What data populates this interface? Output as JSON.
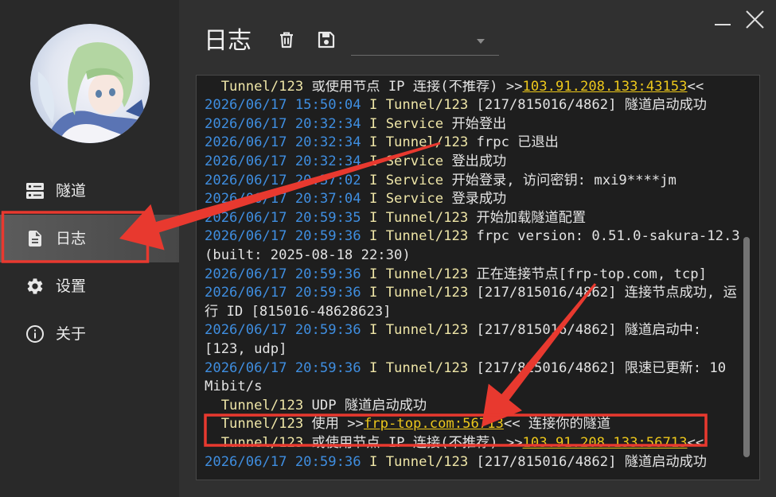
{
  "window_controls": {
    "minimize_icon": "minimize-icon",
    "close_icon": "close-icon"
  },
  "sidebar": {
    "items": [
      {
        "label": "隧道",
        "icon": "server-icon",
        "active": false
      },
      {
        "label": "日志",
        "icon": "file-text-icon",
        "active": true
      },
      {
        "label": "设置",
        "icon": "gear-icon",
        "active": false
      },
      {
        "label": "关于",
        "icon": "info-icon",
        "active": false
      }
    ]
  },
  "header": {
    "title": "日志",
    "clear_icon": "trash-icon",
    "save_icon": "save-icon",
    "filter": {
      "value": "",
      "icon": "chevron-down-icon"
    }
  },
  "log": {
    "lines": [
      {
        "indent": true,
        "source": "Tunnel/123",
        "message": [
          {
            "text": "或使用节点 IP 连接(不推荐) >>"
          },
          {
            "text": "103.91.208.133:43153",
            "link": true
          },
          {
            "text": "<<"
          }
        ]
      },
      {
        "time": "2026/06/17 15:50:04",
        "level": "I",
        "source": "Tunnel/123",
        "message": [
          {
            "text": "[217/815016/4862] 隧道启动成功"
          }
        ]
      },
      {
        "time": "2026/06/17 20:32:34",
        "level": "I",
        "source": "Service",
        "message": [
          {
            "text": "开始登出"
          }
        ]
      },
      {
        "time": "2026/06/17 20:32:34",
        "level": "I",
        "source": "Tunnel/123",
        "message": [
          {
            "text": "frpc 已退出"
          }
        ]
      },
      {
        "time": "2026/06/17 20:32:34",
        "level": "I",
        "source": "Service",
        "message": [
          {
            "text": "登出成功"
          }
        ]
      },
      {
        "time": "2026/06/17 20:37:02",
        "level": "I",
        "source": "Service",
        "message": [
          {
            "text": "开始登录, 访问密钥: mxi9****jm"
          }
        ]
      },
      {
        "time": "2026/06/17 20:37:04",
        "level": "I",
        "source": "Service",
        "message": [
          {
            "text": "登录成功"
          }
        ]
      },
      {
        "time": "2026/06/17 20:59:35",
        "level": "I",
        "source": "Tunnel/123",
        "message": [
          {
            "text": "开始加载隧道配置"
          }
        ]
      },
      {
        "time": "2026/06/17 20:59:36",
        "level": "I",
        "source": "Tunnel/123",
        "message": [
          {
            "text": "frpc version: 0.51.0-sakura-12.3 (built: 2025-08-18 22:30)"
          }
        ]
      },
      {
        "time": "2026/06/17 20:59:36",
        "level": "I",
        "source": "Tunnel/123",
        "message": [
          {
            "text": "正在连接节点[frp-top.com, tcp]"
          }
        ]
      },
      {
        "time": "2026/06/17 20:59:36",
        "level": "I",
        "source": "Tunnel/123",
        "message": [
          {
            "text": "[217/815016/4862] 连接节点成功, 运行 ID [815016-48628623]"
          }
        ]
      },
      {
        "time": "2026/06/17 20:59:36",
        "level": "I",
        "source": "Tunnel/123",
        "message": [
          {
            "text": "[217/815016/4862] 隧道启动中: [123, udp]"
          }
        ]
      },
      {
        "time": "2026/06/17 20:59:36",
        "level": "I",
        "source": "Tunnel/123",
        "message": [
          {
            "text": "[217/815016/4862] 限速已更新: 10 Mibit/s"
          }
        ]
      },
      {
        "indent": true,
        "source": "Tunnel/123",
        "message": [
          {
            "text": "UDP 隧道启动成功"
          }
        ]
      },
      {
        "indent": true,
        "source": "Tunnel/123",
        "message": [
          {
            "text": "使用 >>"
          },
          {
            "text": "frp-top.com:56713",
            "link": true
          },
          {
            "text": "<< 连接你的隧道"
          }
        ]
      },
      {
        "indent": true,
        "source": "Tunnel/123",
        "message": [
          {
            "text": "或使用节点 IP 连接(不推荐) >>"
          },
          {
            "text": "103.91.208.133:56713",
            "link": true
          },
          {
            "text": "<<"
          }
        ]
      },
      {
        "time": "2026/06/17 20:59:36",
        "level": "I",
        "source": "Tunnel/123",
        "message": [
          {
            "text": "[217/815016/4862] 隧道启动成功"
          }
        ]
      }
    ]
  },
  "colors": {
    "timestamp": "#3f8ee0",
    "source": "#eee5a7",
    "message": "#e3e3e3",
    "link": "#ecc71b",
    "active_item": "#474747",
    "annotation": "#e8392f"
  }
}
